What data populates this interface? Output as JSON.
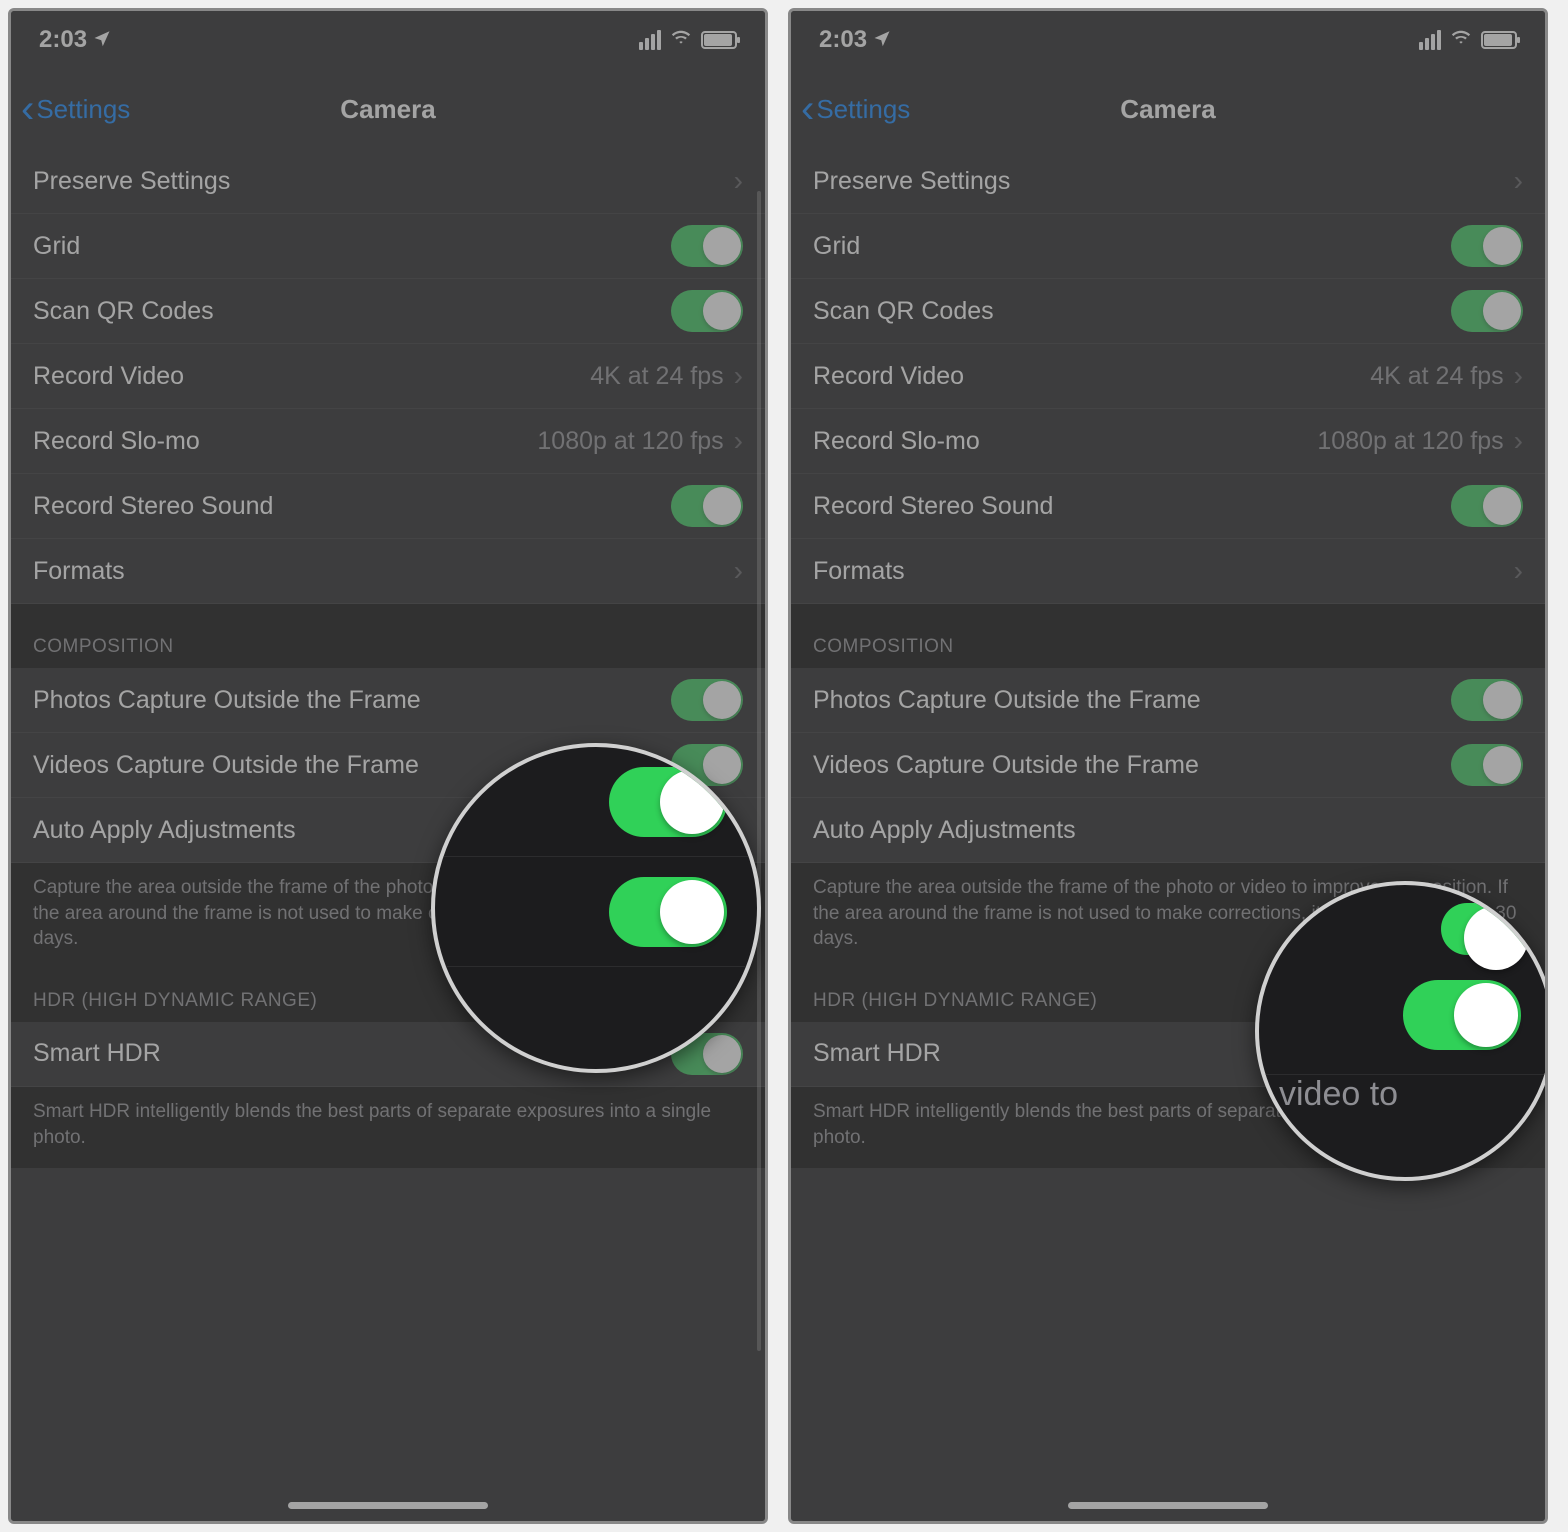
{
  "status": {
    "time": "2:03",
    "location_icon": "◤"
  },
  "nav": {
    "back_label": "Settings",
    "title": "Camera"
  },
  "rows": {
    "preserve": "Preserve Settings",
    "grid": "Grid",
    "scan_qr": "Scan QR Codes",
    "record_video": "Record Video",
    "record_video_value": "4K at 24 fps",
    "record_slomo": "Record Slo-mo",
    "record_slomo_value": "1080p at 120 fps",
    "record_stereo": "Record Stereo Sound",
    "formats": "Formats"
  },
  "composition": {
    "header": "COMPOSITION",
    "photos_outside": "Photos Capture Outside the Frame",
    "videos_outside": "Videos Capture Outside the Frame",
    "auto_apply": "Auto Apply Adjustments",
    "footer": "Capture the area outside the frame of the photo or video to improve composition. If the area around the frame is not used to make corrections, it will be deleted after 30 days."
  },
  "hdr": {
    "header": "HDR (HIGH DYNAMIC RANGE)",
    "smart_hdr": "Smart HDR",
    "footer": "Smart HDR intelligently blends the best parts of separate exposures into a single photo."
  },
  "magnifier2_text": "video to"
}
